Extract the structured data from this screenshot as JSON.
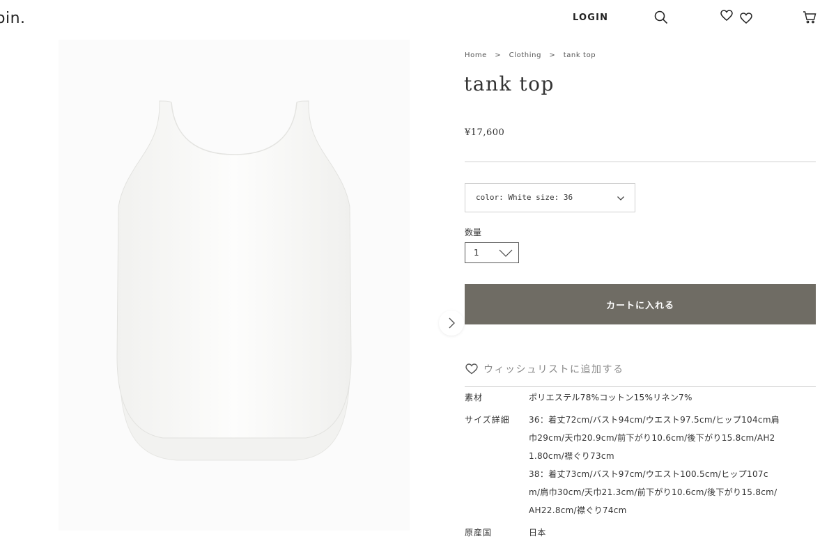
{
  "header": {
    "logo": "oin.",
    "login_label": "LOGIN",
    "icons": [
      "search-icon",
      "heart-icon",
      "cart-icon"
    ]
  },
  "gallery": {
    "next_icon": "chevron-right-icon"
  },
  "breadcrumb": {
    "items": [
      "Home",
      "Clothing",
      "tank top"
    ],
    "separator": ">"
  },
  "product": {
    "title": "tank top",
    "price": "¥17,600",
    "variant_selected": "color: White size: 36",
    "quantity_label": "数量",
    "quantity_value": "1",
    "add_to_cart_label": "カートに入れる",
    "wishlist_label": "ウィッシュリストに追加する"
  },
  "specs": [
    {
      "label": "素材",
      "lines": [
        "ポリエステル78%コットン15%リネン7%"
      ]
    },
    {
      "label": "サイズ詳細",
      "lines": [
        "36：着丈72cm/バスト94cm/ウエスト97.5cm/ヒップ104cm肩",
        "巾29cm/天巾20.9cm/前下がり10.6cm/後下がり15.8cm/AH2",
        "1.80cm/襟ぐり73cm",
        "38：着丈73cm/バスト97cm/ウエスト100.5cm/ヒップ107c",
        "m/肩巾30cm/天巾21.3cm/前下がり10.6cm/後下がり15.8cm/",
        "AH22.8cm/襟ぐり74cm"
      ]
    },
    {
      "label": "原産国",
      "lines": [
        "日本"
      ]
    }
  ],
  "colors": {
    "button_bg": "#6f6c64",
    "divider": "#cfcfcf"
  }
}
